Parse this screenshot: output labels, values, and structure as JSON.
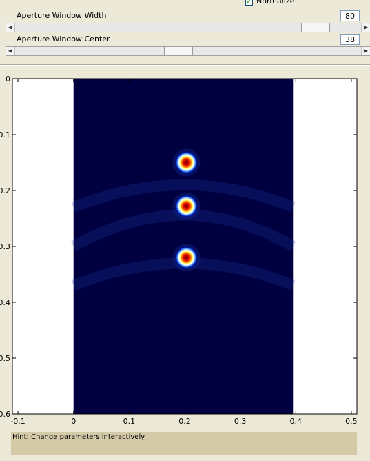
{
  "controls": {
    "normalize_label": "Normalize",
    "normalize_checked": true,
    "width_label": "Aperture Window Width",
    "width_value": "80",
    "width_slider_fraction": 0.9,
    "center_label": "Aperture Window Center",
    "center_value": "38",
    "center_slider_fraction": 0.47
  },
  "chart_data": {
    "type": "heatmap",
    "colormap": "jet",
    "x_ticks": [
      "-0.1",
      "0",
      "0.1",
      "0.2",
      "0.3",
      "0.4",
      "0.5"
    ],
    "y_ticks": [
      "0",
      "0.1",
      "0.2",
      "0.3",
      "0.4",
      "0.5",
      "0.6"
    ],
    "xlim": [
      -0.11,
      0.51
    ],
    "ylim": [
      0,
      0.6
    ],
    "image_x_range": [
      0,
      0.395
    ],
    "image_y_range": [
      0,
      0.6
    ],
    "hotspots": [
      {
        "x": 0.203,
        "y": 0.15
      },
      {
        "x": 0.203,
        "y": 0.228
      },
      {
        "x": 0.203,
        "y": 0.32
      }
    ],
    "background_color": "#000040"
  },
  "hint": {
    "text": "Hint: Change parameters interactively"
  }
}
